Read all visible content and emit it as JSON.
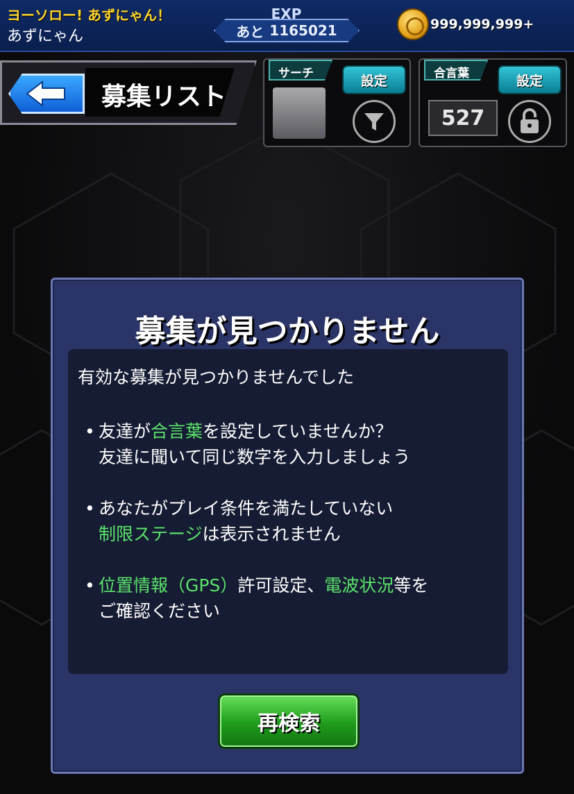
{
  "header": {
    "player_title": "ヨーソロー! あずにゃん！",
    "player_name": "あずにゃん",
    "exp_label": "EXP",
    "exp_remaining_prefix": "あと",
    "exp_remaining_value": "1165021",
    "coin_count": "999,999,999+"
  },
  "page": {
    "title": "募集リスト"
  },
  "search_panel": {
    "tag": "サーチ",
    "set_label": "設定"
  },
  "passphrase_panel": {
    "tag": "合言葉",
    "set_label": "設定",
    "code": "527"
  },
  "dialog": {
    "title": "募集が見つかりません",
    "lead": "有効な募集が見つかりませんでした",
    "bullet1": {
      "a": "友達が",
      "hl": "合言葉",
      "b": "を設定していませんか？",
      "line2": "友達に聞いて同じ数字を入力しましょう"
    },
    "bullet2": {
      "line1": "あなたがプレイ条件を満たしていない",
      "hl": "制限ステージ",
      "b": "は表示されません"
    },
    "bullet3": {
      "hl1": "位置情報（GPS）",
      "a": "許可設定、",
      "hl2": "電波状況",
      "b": "等を",
      "line2": "ご確認ください"
    },
    "retry_label": "再検索"
  },
  "colors": {
    "highlight": "#5be36b",
    "dialog_bg": "#2a3466",
    "retry_button": "#1f9b1c",
    "set_button": "#0a7e92"
  }
}
